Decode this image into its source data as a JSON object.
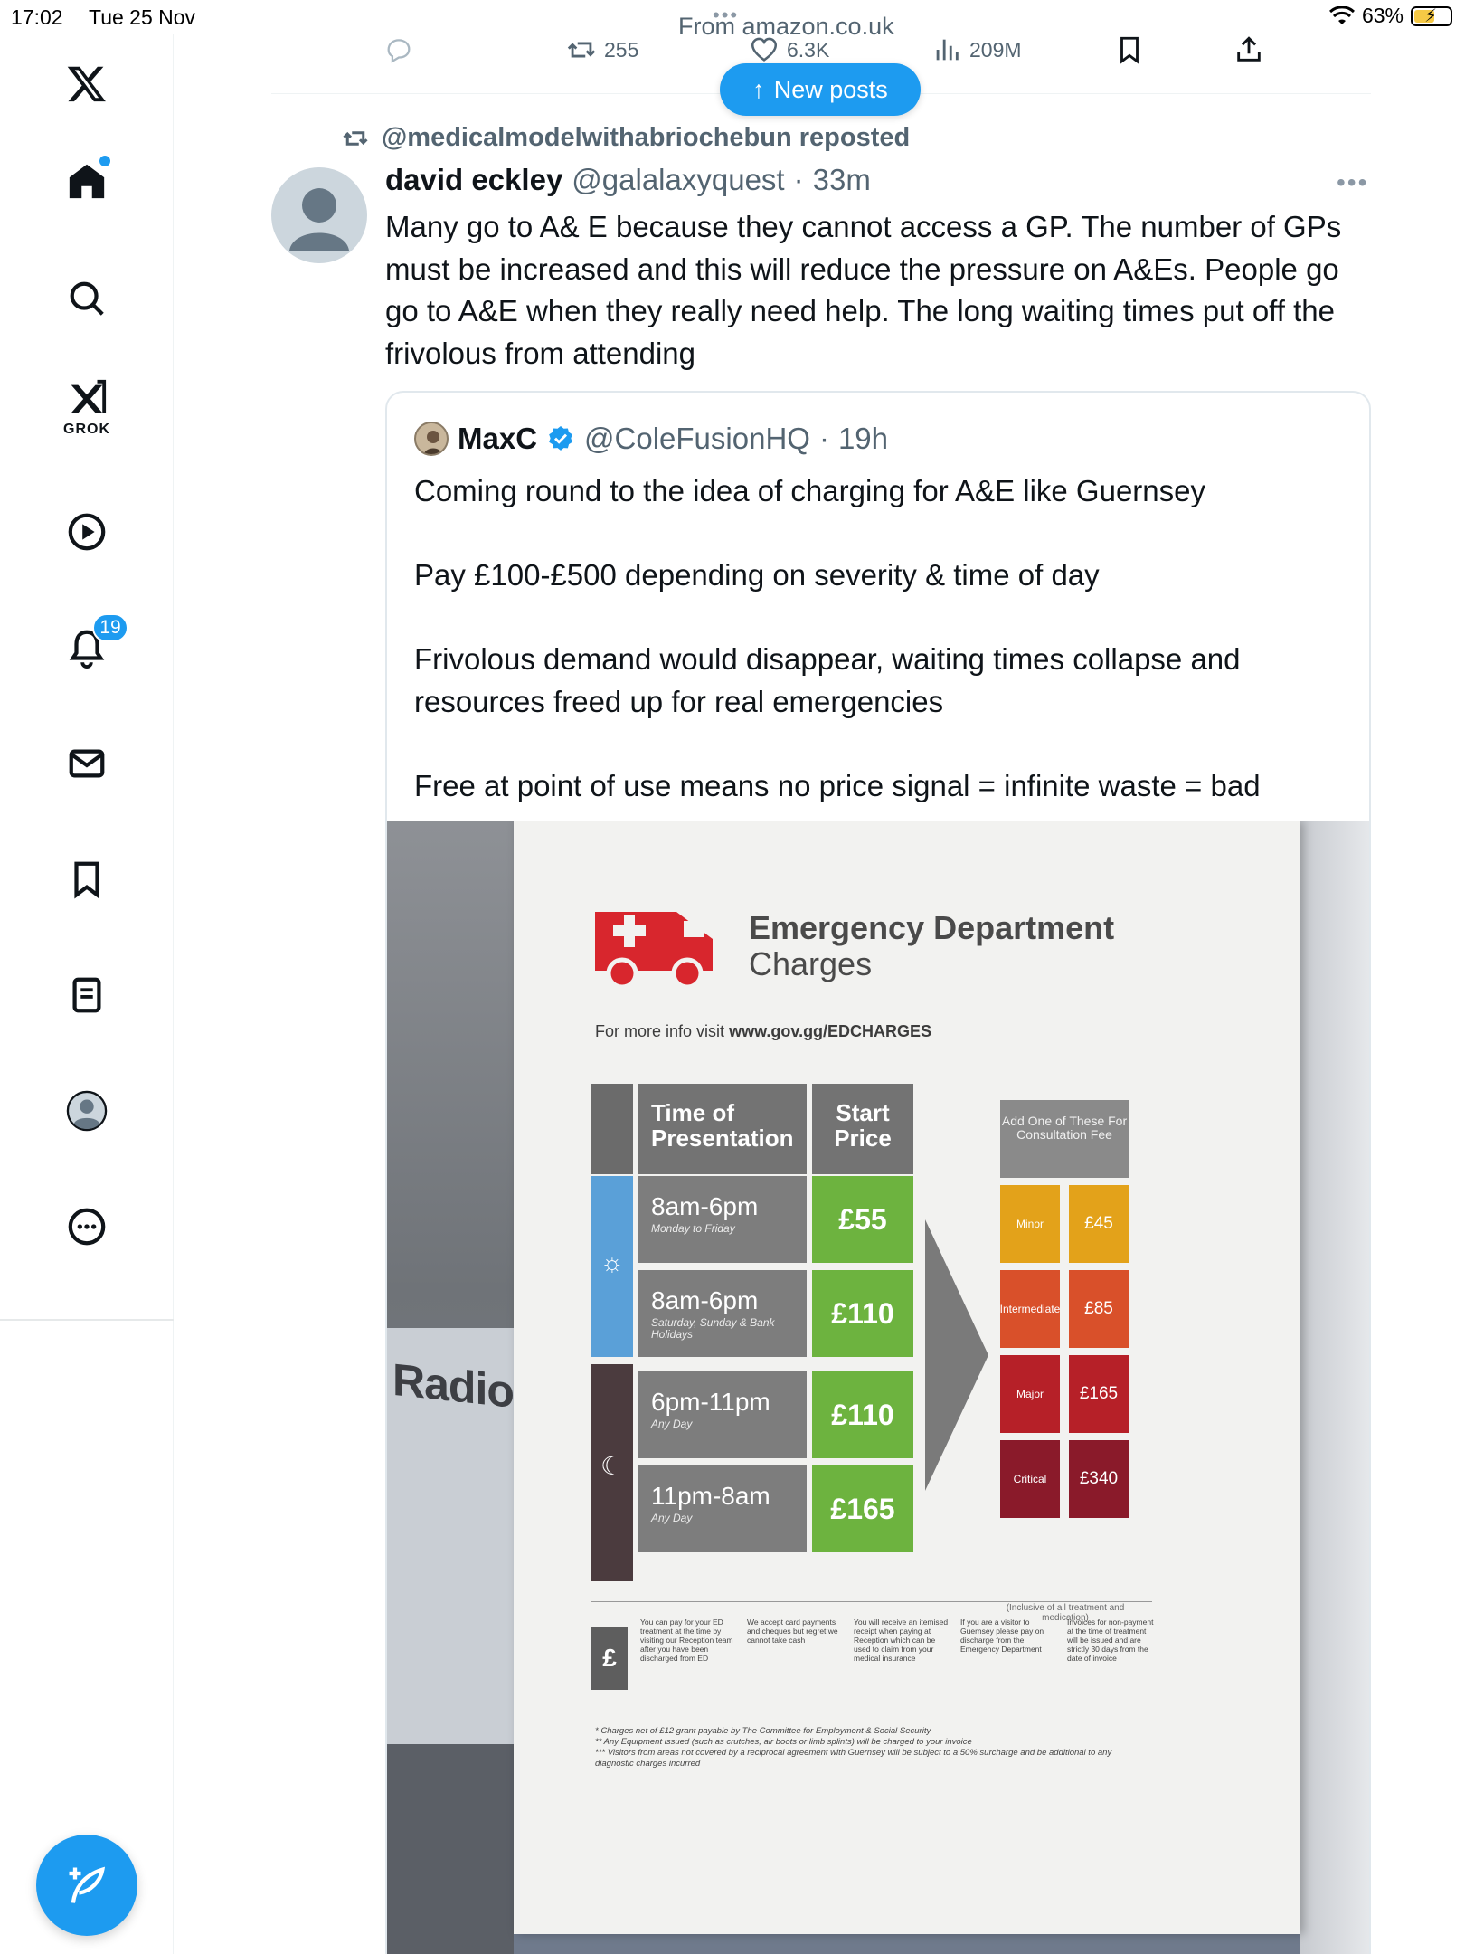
{
  "status_bar": {
    "time": "17:02",
    "date": "Tue 25 Nov",
    "battery": "63%",
    "battery_level": 0.63
  },
  "sidebar": {
    "items": [
      {
        "name": "home",
        "icon": "home-icon"
      },
      {
        "name": "explore",
        "icon": "search-icon"
      },
      {
        "name": "grok",
        "icon": "grok-icon",
        "label": "GROK"
      },
      {
        "name": "video",
        "icon": "play-icon"
      },
      {
        "name": "notifications",
        "icon": "bell-icon",
        "badge": "19"
      },
      {
        "name": "messages",
        "icon": "mail-icon"
      },
      {
        "name": "bookmarks",
        "icon": "bookmark-icon"
      },
      {
        "name": "lists",
        "icon": "list-icon"
      },
      {
        "name": "profile",
        "icon": "avatar-icon"
      },
      {
        "name": "more",
        "icon": "more-icon"
      }
    ],
    "accent": "#1d9bf0"
  },
  "previous_post": {
    "partial_text": "From amazon.co.uk",
    "reposts": "255",
    "likes": "6.3K",
    "views": "209M"
  },
  "new_posts_label": "New posts",
  "post": {
    "repost_label": "@medicalmodelwithabriochebun reposted",
    "author_name": "david eckley",
    "author_handle": "@galalaxyquest",
    "time": "33m",
    "text": "Many go to A& E because they cannot access a GP. The number of GPs must be increased and this will reduce the pressure on A&Es. People go go to A&E when they really need help. The long waiting times put off the frivolous from attending"
  },
  "quote": {
    "author_name": "MaxC",
    "author_handle": "@ColeFusionHQ",
    "time": "19h",
    "paragraphs": [
      "Coming round to the idea of charging for A&E like Guernsey",
      "Pay £100-£500 depending on severity & time of day",
      "Frivolous demand would disappear, waiting times collapse and resources freed up for real emergencies",
      "Free at point of use means no price signal = infinite waste = bad"
    ]
  },
  "poster": {
    "background_sign": "Radiology",
    "title": "Emergency Department",
    "subtitle": "Charges",
    "info": "For more info visit",
    "info_url": "www.gov.gg/EDCHARGES",
    "col_time": "Time of Presentation",
    "col_price": "Start Price",
    "rows": [
      {
        "time": "8am-6pm",
        "days": "Monday to Friday",
        "price": "£55"
      },
      {
        "time": "8am-6pm",
        "days": "Saturday, Sunday & Bank Holidays",
        "price": "£110"
      },
      {
        "time": "6pm-11pm",
        "days": "Any Day",
        "price": "£110"
      },
      {
        "time": "11pm-8am",
        "days": "Any Day",
        "price": "£165"
      }
    ],
    "fee_head": "Add One of These For Consultation Fee",
    "fees": [
      {
        "label": "Minor",
        "value": "£45",
        "color": "#e3a21a"
      },
      {
        "label": "Intermediate",
        "value": "£85",
        "color": "#d9502a"
      },
      {
        "label": "Major",
        "value": "£165",
        "color": "#b62028"
      },
      {
        "label": "Critical",
        "value": "£340",
        "color": "#8a1a2a"
      }
    ],
    "fee_note": "(Inclusive of all treatment and medication)",
    "pound_symbol": "£",
    "footer_cols": [
      "You can pay for your ED treatment at the time by visiting our Reception team after you have been discharged from ED",
      "We accept card payments and cheques but regret we cannot take cash",
      "You will receive an itemised receipt when paying at Reception which can be used to claim from your medical insurance",
      "If you are a visitor to Guernsey please pay on discharge from the Emergency Department",
      "Invoices for non-payment at the time of treatment will be issued and are strictly 30 days from the date of invoice"
    ],
    "notes": [
      "* Charges net of £12 grant payable by The Committee for Employment & Social Security",
      "** Any Equipment issued (such as crutches, air boots or limb splints) will be charged to your invoice",
      "*** Visitors from areas not covered by a reciprocal agreement with Guernsey will be subject to a 50% surcharge and be additional to any diagnostic charges incurred"
    ]
  }
}
